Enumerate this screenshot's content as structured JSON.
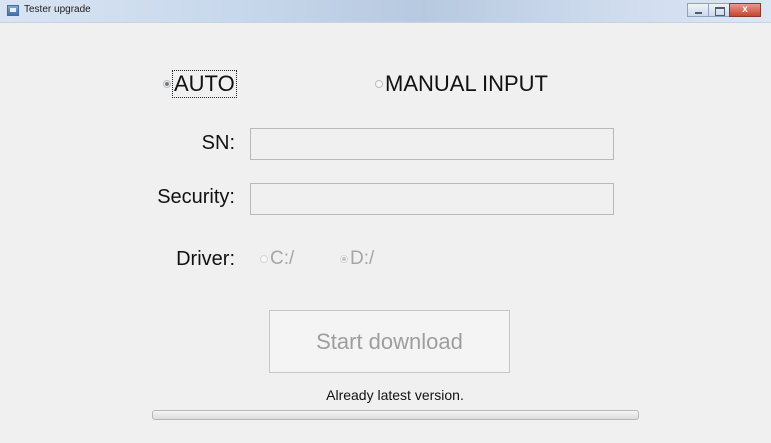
{
  "window": {
    "title": "Tester upgrade",
    "close_glyph": "x"
  },
  "mode": {
    "auto_label": "AUTO",
    "manual_label": "MANUAL INPUT",
    "selected": "AUTO"
  },
  "form": {
    "sn_label": "SN:",
    "sn_value": "",
    "security_label": "Security:",
    "security_value": "",
    "driver_label": "Driver:",
    "driver_options": [
      "C:/",
      "D:/"
    ],
    "driver_selected": "D:/"
  },
  "actions": {
    "start_label": "Start download"
  },
  "status": {
    "message": "Already latest version.",
    "progress": 0.0
  }
}
